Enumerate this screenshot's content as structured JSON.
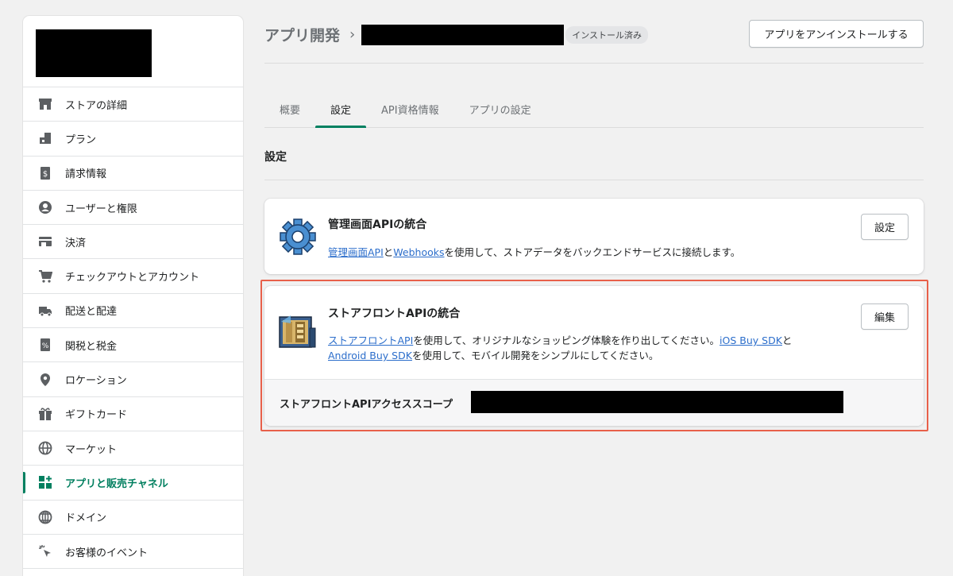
{
  "sidebar": {
    "items": [
      {
        "label": "ストアの詳細",
        "icon": "store-icon",
        "active": false
      },
      {
        "label": "プラン",
        "icon": "plan-icon",
        "active": false
      },
      {
        "label": "請求情報",
        "icon": "billing-icon",
        "active": false
      },
      {
        "label": "ユーザーと権限",
        "icon": "user-icon",
        "active": false
      },
      {
        "label": "決済",
        "icon": "payments-icon",
        "active": false
      },
      {
        "label": "チェックアウトとアカウント",
        "icon": "cart-icon",
        "active": false
      },
      {
        "label": "配送と配達",
        "icon": "truck-icon",
        "active": false
      },
      {
        "label": "関税と税金",
        "icon": "tax-icon",
        "active": false
      },
      {
        "label": "ロケーション",
        "icon": "location-pin-icon",
        "active": false
      },
      {
        "label": "ギフトカード",
        "icon": "gift-icon",
        "active": false
      },
      {
        "label": "マーケット",
        "icon": "globe-icon",
        "active": false
      },
      {
        "label": "アプリと販売チャネル",
        "icon": "apps-icon",
        "active": true
      },
      {
        "label": "ドメイン",
        "icon": "domain-globe-icon",
        "active": false
      },
      {
        "label": "お客様のイベント",
        "icon": "cursor-click-icon",
        "active": false
      }
    ]
  },
  "header": {
    "breadcrumb_root": "アプリ開発",
    "chevron": "›",
    "badge": "インストール済み",
    "uninstall_label": "アプリをアンインストールする"
  },
  "tabs": [
    {
      "label": "概要",
      "active": false
    },
    {
      "label": "設定",
      "active": true
    },
    {
      "label": "API資格情報",
      "active": false
    },
    {
      "label": "アプリの設定",
      "active": false
    }
  ],
  "section_title": "設定",
  "admin_card": {
    "icon": "gear-icon",
    "title": "管理画面APIの統合",
    "link1": "管理画面API",
    "text1": "と",
    "link2": "Webhooks",
    "text2": "を使用して、ストアデータをバックエンドサービスに接続します。",
    "button": "設定"
  },
  "storefront_card": {
    "icon": "storefront-icon",
    "title": "ストアフロントAPIの統合",
    "link1": "ストアフロントAPI",
    "text1": "を使用して、オリジナルなショッピング体験を作り出してください。",
    "link2": "iOS Buy SDK",
    "text2": "と",
    "link3": "Android Buy SDK",
    "text3": "を使用して、モバイル開発をシンプルにしてください。",
    "button": "編集",
    "footer_label": "ストアフロントAPIアクセススコープ"
  },
  "colors": {
    "accent": "#008060",
    "link": "#2c6ecb",
    "highlight": "#e8604a"
  }
}
